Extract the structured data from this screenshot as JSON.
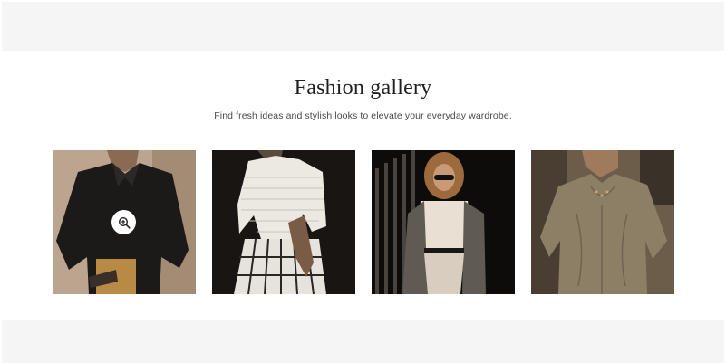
{
  "gallery": {
    "title": "Fashion gallery",
    "subtitle": "Find fresh ideas and stylish looks to elevate your everyday wardrobe."
  },
  "items": [
    {
      "icon": "zoom-in-icon",
      "hovered": true
    },
    {
      "icon": "zoom-in-icon",
      "hovered": false
    },
    {
      "icon": "zoom-in-icon",
      "hovered": false
    },
    {
      "icon": "zoom-in-icon",
      "hovered": false
    }
  ],
  "colors": {
    "band": "#f5f5f5",
    "title": "#1f1f1f",
    "subtitle": "#4a4a4a"
  }
}
